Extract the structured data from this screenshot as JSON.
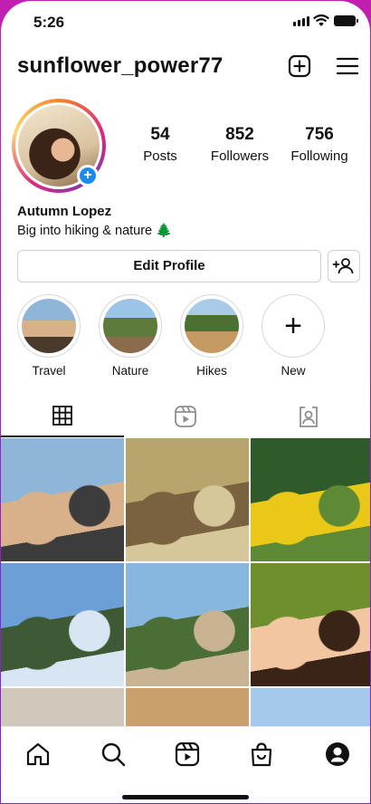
{
  "status_bar": {
    "time": "5:26"
  },
  "header": {
    "username": "sunflower_power77",
    "icons": [
      "new-post-icon",
      "menu-icon"
    ]
  },
  "profile": {
    "stats": [
      {
        "value": "54",
        "label": "Posts"
      },
      {
        "value": "852",
        "label": "Followers"
      },
      {
        "value": "756",
        "label": "Following"
      }
    ],
    "name": "Autumn Lopez",
    "bio": "Big into hiking & nature 🌲",
    "edit_label": "Edit Profile"
  },
  "highlights": [
    {
      "label": "Travel"
    },
    {
      "label": "Nature"
    },
    {
      "label": "Hikes"
    },
    {
      "label": "New"
    }
  ],
  "tabs": [
    "grid-icon",
    "reels-icon",
    "tagged-icon"
  ],
  "grid_posts": [
    {
      "desc": "friends selfie at beach",
      "colors": [
        "#8fb6d9",
        "#d8b08a",
        "#3c3c3c"
      ]
    },
    {
      "desc": "kids playing by the water",
      "colors": [
        "#b6a66b",
        "#7a6240",
        "#d6c79a"
      ]
    },
    {
      "desc": "yellow wildflowers",
      "colors": [
        "#2f5a2a",
        "#e9c818",
        "#5e8a35"
      ]
    },
    {
      "desc": "coastal cliff and ocean",
      "colors": [
        "#6b9fd6",
        "#3d5a35",
        "#d8e6f3"
      ]
    },
    {
      "desc": "tree by the sea",
      "colors": [
        "#87b7df",
        "#4b6d36",
        "#c8b392"
      ]
    },
    {
      "desc": "two friends smiling",
      "colors": [
        "#6f8f2f",
        "#f2c6a0",
        "#3a2418"
      ]
    },
    {
      "desc": "rocky beach",
      "colors": [
        "#d0c9bb",
        "#8c7b65",
        "#e9e4da"
      ]
    },
    {
      "desc": "sand dunes",
      "colors": [
        "#c9a06c",
        "#8a6538",
        "#e7c99b"
      ]
    },
    {
      "desc": "sky with clouds",
      "colors": [
        "#a5c9ea",
        "#e2eef8",
        "#7fb0de"
      ]
    }
  ],
  "bottom_nav": [
    "home-icon",
    "search-icon",
    "reels-icon",
    "shop-icon",
    "profile-icon"
  ],
  "colors": {
    "accent": "#1a8cf0",
    "text": "#111111",
    "border": "#cfcfcf"
  }
}
